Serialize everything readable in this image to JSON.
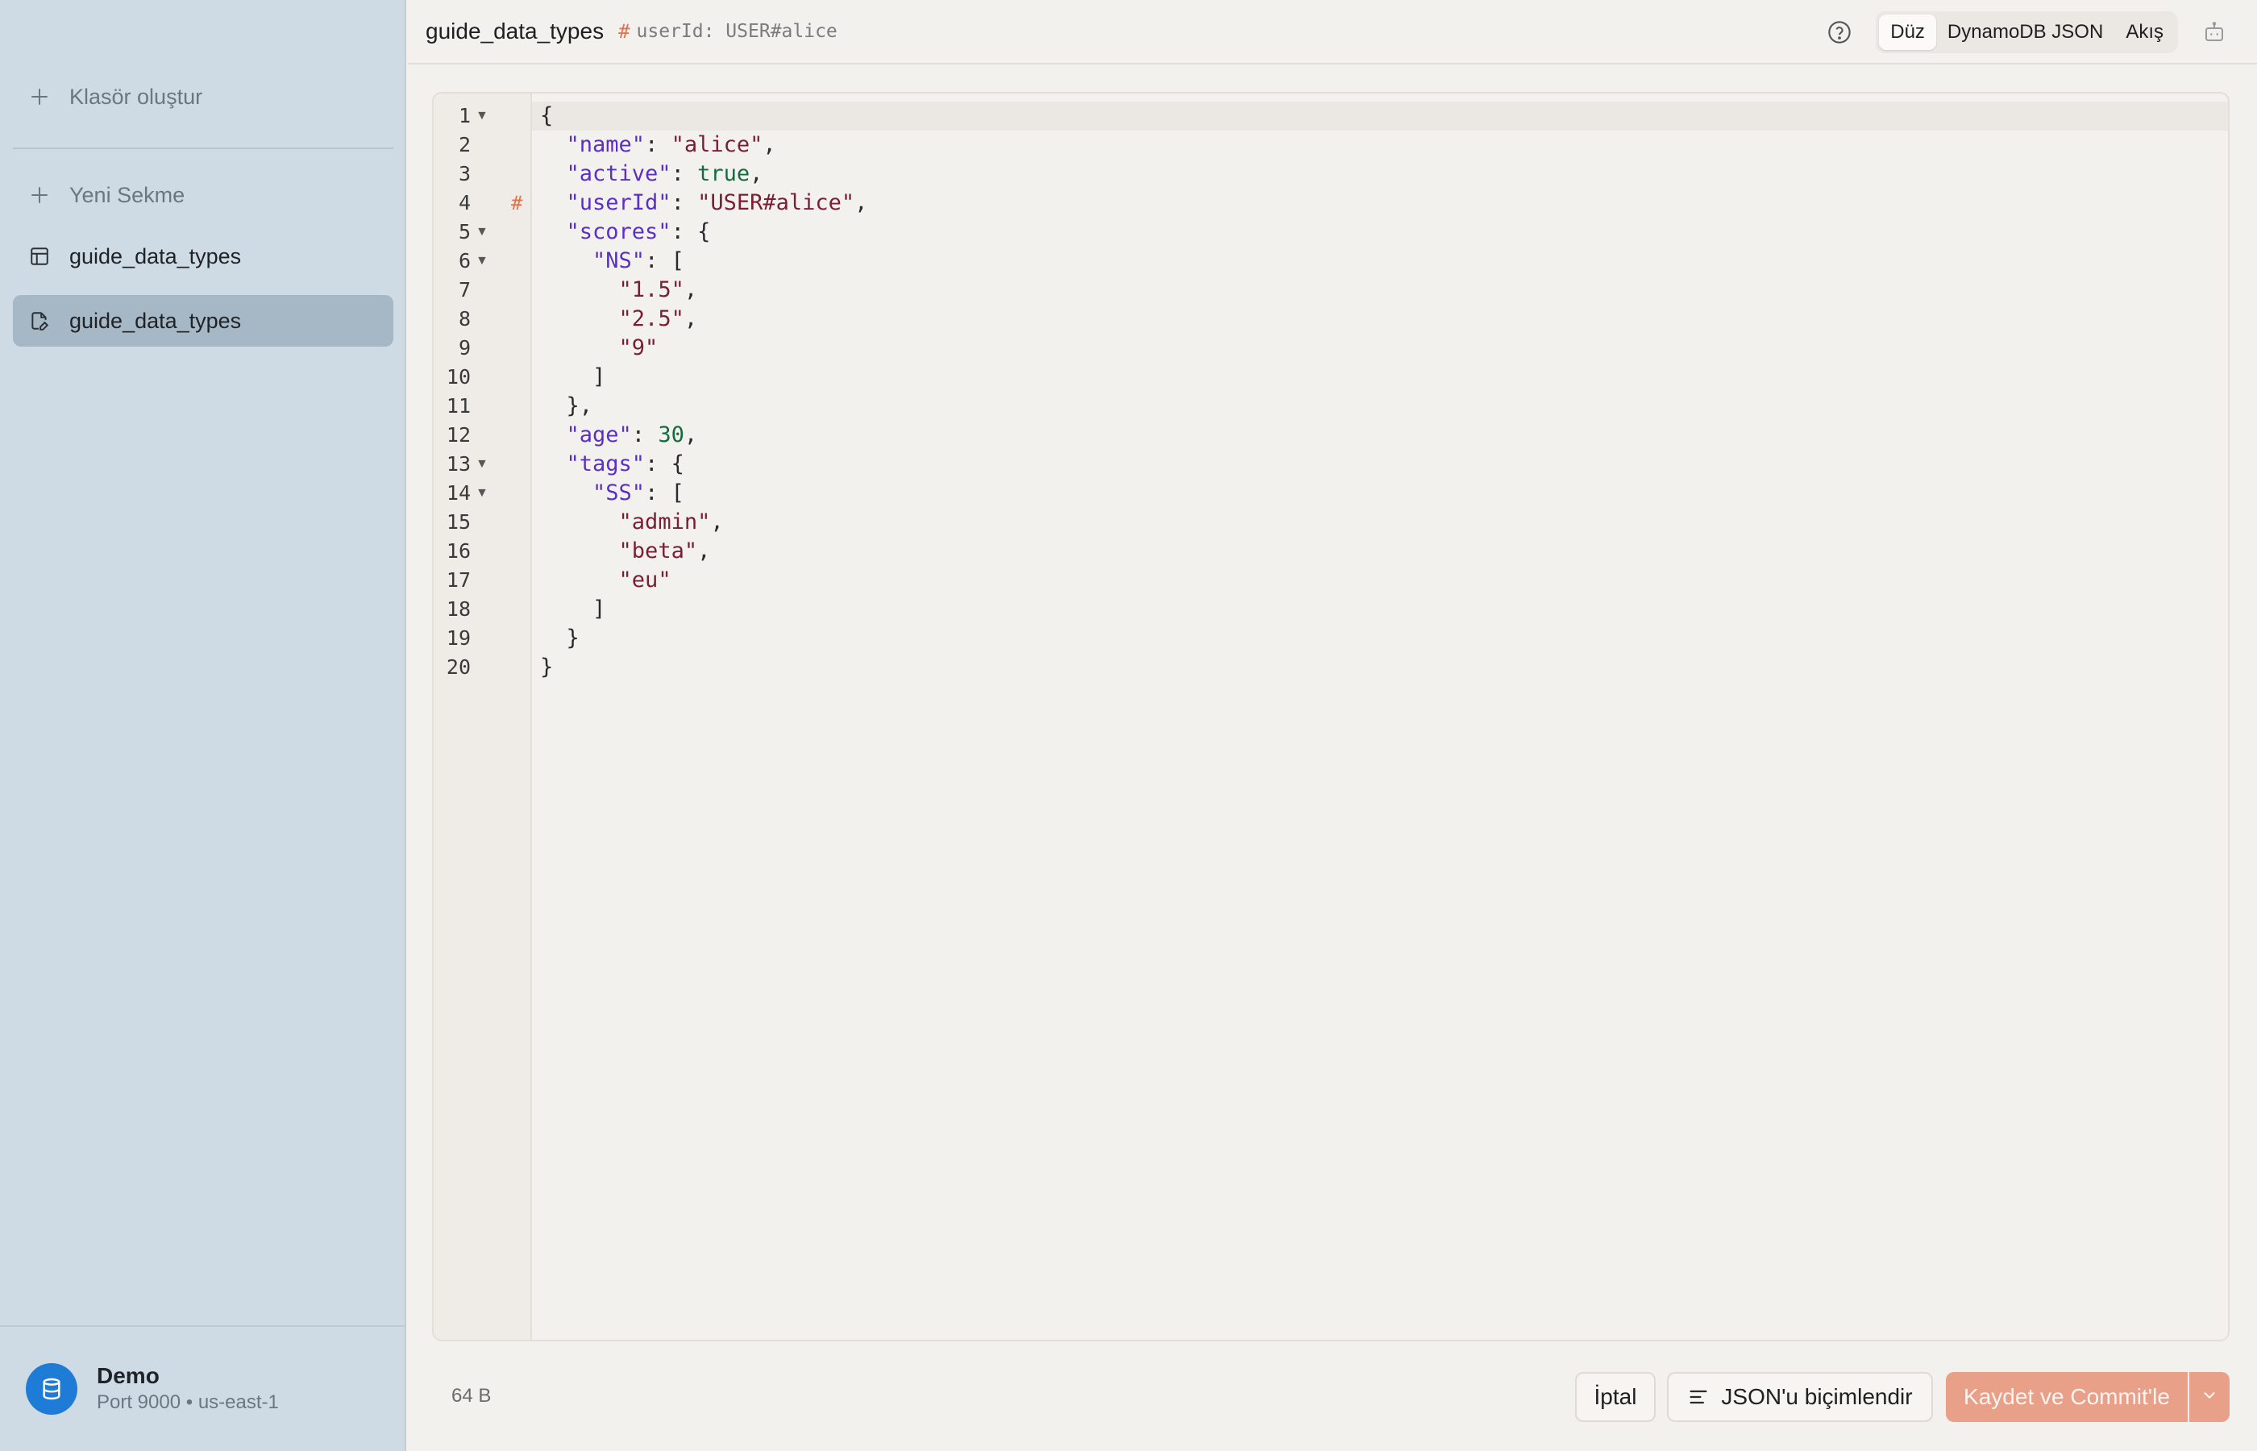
{
  "sidebar": {
    "create_folder": "Klasör oluştur",
    "new_tab": "Yeni Sekme",
    "items": [
      {
        "label": "guide_data_types",
        "icon": "table-icon"
      },
      {
        "label": "guide_data_types",
        "icon": "document-edit-icon"
      }
    ],
    "connection": {
      "name": "Demo",
      "detail": "Port 9000 • us-east-1",
      "color": "#1e7bd6"
    }
  },
  "header": {
    "title": "guide_data_types",
    "key_hash": "#",
    "key_label": "userId: USER#alice",
    "view_modes": [
      "Düz",
      "DynamoDB JSON",
      "Akış"
    ],
    "active_view_mode": "Düz"
  },
  "editor": {
    "line_numbers": [
      "1",
      "2",
      "3",
      "4",
      "5",
      "6",
      "7",
      "8",
      "9",
      "10",
      "11",
      "12",
      "13",
      "14",
      "15",
      "16",
      "17",
      "18",
      "19",
      "20"
    ],
    "key_marker": "#",
    "tokens": {
      "open_brace": "{",
      "close_brace": "}",
      "open_bracket": "[",
      "close_bracket": "]",
      "colon": ": ",
      "comma": ",",
      "close_brace_comma": "},",
      "name_key": "\"name\"",
      "name_val": "\"alice\"",
      "active_key": "\"active\"",
      "active_val": "true",
      "userId_key": "\"userId\"",
      "userId_val": "\"USER#alice\"",
      "scores_key": "\"scores\"",
      "ns_key": "\"NS\"",
      "ns_1": "\"1.5\"",
      "ns_2": "\"2.5\"",
      "ns_3": "\"9\"",
      "age_key": "\"age\"",
      "age_val": "30",
      "tags_key": "\"tags\"",
      "ss_key": "\"SS\"",
      "ss_1": "\"admin\"",
      "ss_2": "\"beta\"",
      "ss_3": "\"eu\""
    }
  },
  "footer": {
    "size": "64 B",
    "cancel_label": "İptal",
    "format_label": "JSON'u biçimlendir",
    "save_label": "Kaydet ve Commit'le"
  },
  "colors": {
    "accent": "#e8a089",
    "key": "#5b2fc2",
    "string": "#7a1f33",
    "number": "#136b3e",
    "marker": "#e0734e"
  }
}
